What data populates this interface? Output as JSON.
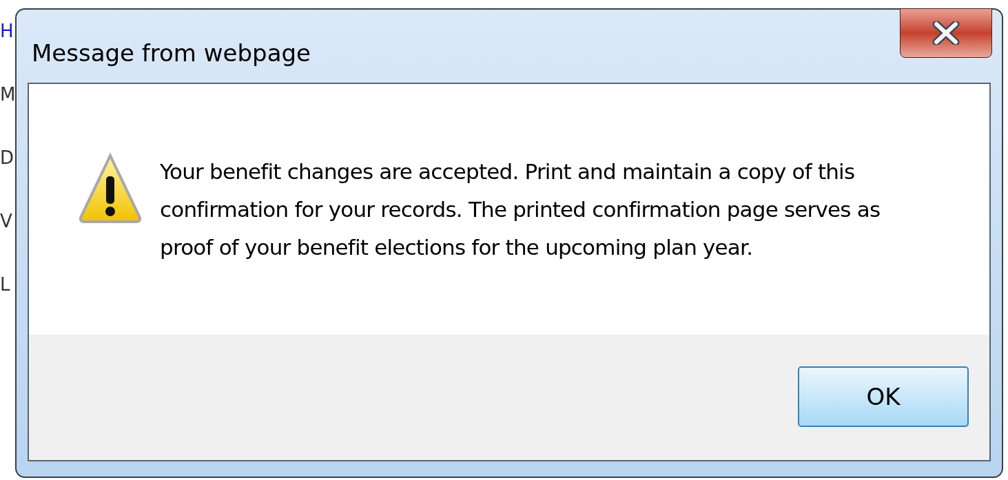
{
  "background_page": {
    "letters": [
      {
        "text": "H",
        "kind": "link"
      },
      {
        "text": "M",
        "kind": "plain"
      },
      {
        "text": "D",
        "kind": "plain"
      },
      {
        "text": "V",
        "kind": "plain"
      },
      {
        "text": "L",
        "kind": "plain"
      }
    ]
  },
  "dialog": {
    "title": "Message from webpage",
    "kind": "warning",
    "message": "Your benefit changes are accepted. Print and maintain a copy of this confirmation for your records. The printed confirmation page serves as proof of your benefit elections for the upcoming plan year.",
    "buttons": [
      {
        "label": "OK",
        "default": true
      }
    ]
  }
}
